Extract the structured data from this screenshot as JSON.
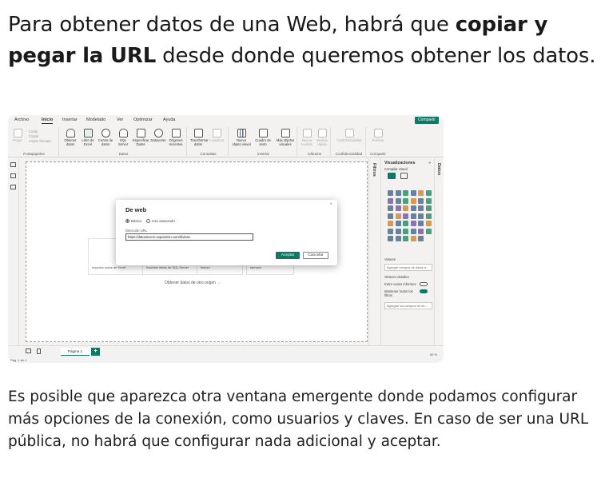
{
  "heading": {
    "part1": "Para obtener datos de una Web, habrá que ",
    "bold1": "copiar y pegar la URL",
    "part2": " desde donde queremos obtener los datos."
  },
  "screenshot": {
    "menu": [
      "Archivo",
      "Inicio",
      "Insertar",
      "Modelado",
      "Ver",
      "Optimizar",
      "Ayuda"
    ],
    "active_menu": "Inicio",
    "share_label": "Compartir",
    "ribbon": {
      "clipboard_items": [
        "Cortar",
        "Copiar",
        "Copiar formato"
      ],
      "paste_label": "Pegar",
      "groups": [
        "Portapapeles",
        "Datos",
        "Consultas",
        "Insertar",
        "Cálculos",
        "Confidencialidad",
        "Compartir"
      ],
      "buttons": [
        "Obtener datos",
        "Libro de Excel",
        "Centro de datos",
        "SQL Server",
        "Especificar Datos",
        "Dataverse",
        "Orígenes recientes",
        "Transformar datos",
        "Actualizar",
        "Nuevo objeto visual",
        "Cuadro de texto",
        "Más objetos visuales",
        "Nueva medida",
        "Medida rápida",
        "Confidencialidad",
        "Publicar"
      ]
    },
    "tiles": [
      "Importar datos de Excel",
      "Importar datos de SQL Server",
      "Pegar datos en una tabla en blanco",
      "Usar un modelo semántico de ejemplo"
    ],
    "more_link": "Obtener datos de otro origen →",
    "dialog": {
      "title": "De web",
      "radio_basic": "Básico",
      "radio_advanced": "Uso avanzado",
      "url_label": "Dirección URL",
      "url_value": "https://datosmacro.expansion.com/divisas",
      "ok": "Aceptar",
      "cancel": "Cancelar"
    },
    "filters_label": "Filtros",
    "data_label": "Datos",
    "viz": {
      "title": "Visualizaciones",
      "subtitle": "Compilar visual",
      "values_label": "Valores",
      "values_placeholder": "Agregar campos de datos a...",
      "drill_label": "Obtener detalles",
      "cross_report": "Entre varios informes",
      "keep_filters": "Mantener todos los filtros",
      "drill_placeholder": "Agregue los campos de ob..."
    },
    "page_tab": "Página 1",
    "page_info": "Pág. 1 de 1",
    "zoom": "80 %"
  },
  "paragraph": "Es posible que aparezca otra ventana emergente donde podamos configurar más opciones de la conexión, como usuarios y claves. En caso de ser una URL pública, no habrá que configurar nada adicional y aceptar."
}
